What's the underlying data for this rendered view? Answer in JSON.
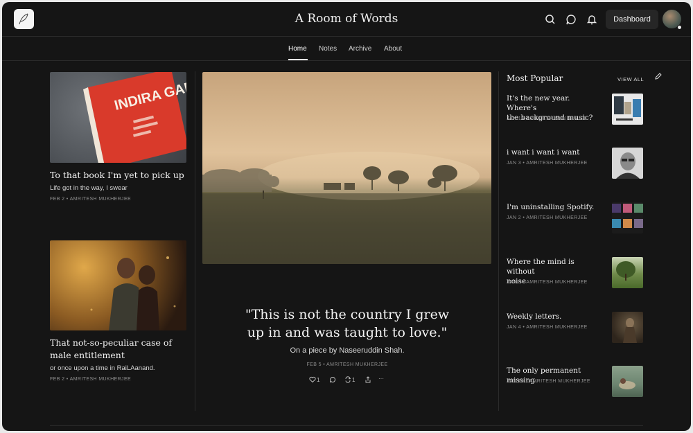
{
  "header": {
    "site_title": "A Room of Words",
    "dashboard_label": "Dashboard"
  },
  "nav": {
    "items": [
      "Home",
      "Notes",
      "Archive",
      "About"
    ],
    "active": "Home"
  },
  "left_cards": [
    {
      "title": "To that book I'm yet to pick up",
      "subtitle": "Life got in the way, I swear",
      "meta": "FEB 2 • AMRITESH MUKHERJEE",
      "book_text": "INDIRA GANDHI"
    },
    {
      "title_line1": "That not-so-peculiar case of",
      "title_line2": "male entitlement",
      "subtitle": "or once upon a time in RaiLAanand.",
      "meta": "FEB 2 • AMRITESH MUKHERJEE"
    }
  ],
  "hero": {
    "quote_line1": "\"This is not the country I grew",
    "quote_line2": "up in and was taught to love.\"",
    "subtitle": "On a piece by Naseeruddin Shah.",
    "meta": "FEB 5 • AMRITESH MUKHERJEE",
    "likes": "1",
    "restacks": "1",
    "more": "···"
  },
  "most_popular": {
    "title": "Most Popular",
    "view_all": "VIEW ALL",
    "items": [
      {
        "title_line1": "It's the new year. Where's",
        "title_line2": "the background music?",
        "meta": "JAN 1 • AMRITESH MUKHERJEE"
      },
      {
        "title_line1": "i want i want i want",
        "title_line2": "",
        "meta": "JAN 3 • AMRITESH MUKHERJEE"
      },
      {
        "title_line1": "I'm uninstalling Spotify.",
        "title_line2": "",
        "meta": "JAN 2 • AMRITESH MUKHERJEE"
      },
      {
        "title_line1": "Where the mind is without",
        "title_line2": "noise",
        "meta": "JAN 9 • AMRITESH MUKHERJEE"
      },
      {
        "title_line1": "Weekly letters.",
        "title_line2": "",
        "meta": "JAN 4 • AMRITESH MUKHERJEE"
      },
      {
        "title_line1": "The only permanent missing.",
        "title_line2": "",
        "meta": "JAN 10 • AMRITESH MUKHERJEE"
      }
    ]
  },
  "colors": {
    "background": "#151515",
    "divider": "#2b2b2b",
    "text": "#f0f0f0",
    "muted": "#8e8e8e",
    "book_red": "#d93a2b"
  }
}
